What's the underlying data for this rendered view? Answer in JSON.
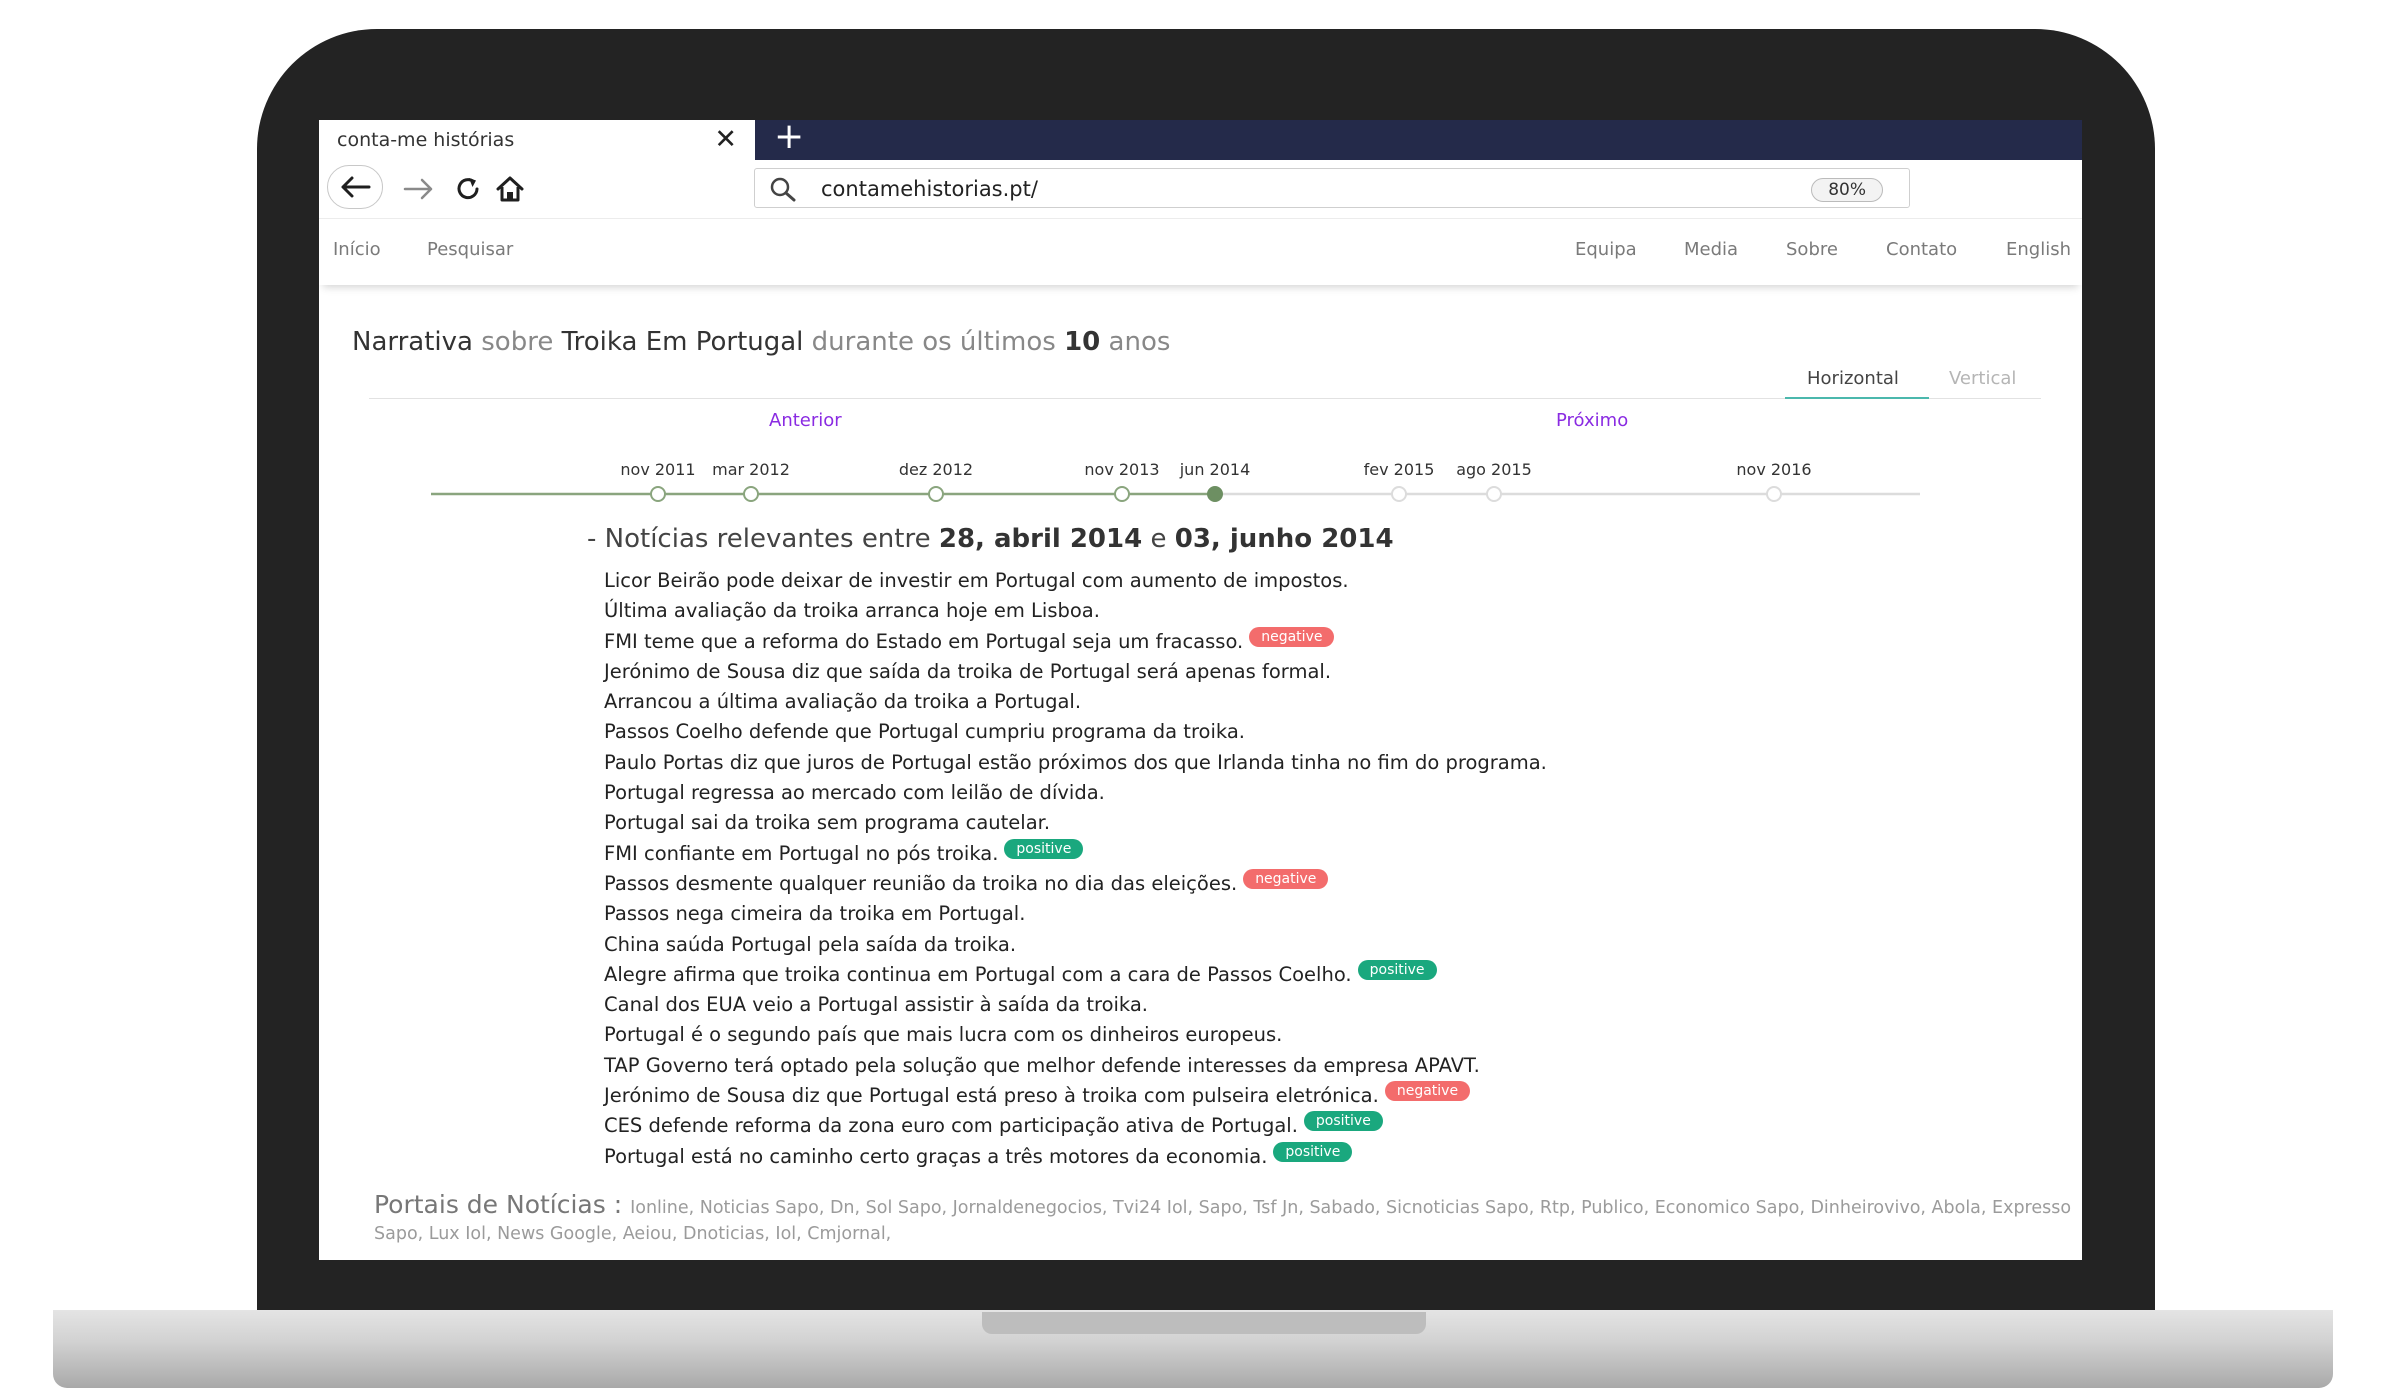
{
  "browser": {
    "tab_title": "conta-me histórias",
    "tab_close": "✕",
    "new_tab": "+",
    "url": "contamehistorias.pt/",
    "zoom": "80%"
  },
  "site_nav": {
    "left": [
      "Início",
      "Pesquisar"
    ],
    "right": [
      "Equipa",
      "Media",
      "Sobre",
      "Contato",
      "English"
    ]
  },
  "heading": {
    "part1": "Narrativa",
    "part2": " sobre ",
    "part3": "Troika Em Portugal",
    "part4": " durante os últimos ",
    "part5": "10",
    "part6": " anos"
  },
  "view_tabs": {
    "horizontal": "Horizontal",
    "vertical": "Vertical",
    "active": "horizontal"
  },
  "pager": {
    "previous": "Anterior",
    "next": "Próximo"
  },
  "timeline": {
    "dates": [
      "nov 2011",
      "mar 2012",
      "dez 2012",
      "nov 2013",
      "jun 2014",
      "fev 2015",
      "ago 2015",
      "nov 2016"
    ],
    "selected_index": 4,
    "colors": {
      "active_line": "#8aa57e",
      "inactive_line": "#dcdcdc",
      "selected_dot": "#6d8f62"
    }
  },
  "news_section": {
    "prefix": "- Notícias relevantes entre ",
    "start_date": "28, abril 2014",
    "connector": " e ",
    "end_date": "03, junho 2014"
  },
  "news": [
    {
      "text": "Licor Beirão pode deixar de investir em Portugal com aumento de impostos.",
      "badge": ""
    },
    {
      "text": "Última avaliação da troika arranca hoje em Lisboa.",
      "badge": ""
    },
    {
      "text": "FMI teme que a reforma do Estado em Portugal seja um fracasso.",
      "badge": "negative"
    },
    {
      "text": "Jerónimo de Sousa diz que saída da troika de Portugal será apenas formal.",
      "badge": ""
    },
    {
      "text": "Arrancou a última avaliação da troika a Portugal.",
      "badge": ""
    },
    {
      "text": "Passos Coelho defende que Portugal cumpriu programa da troika.",
      "badge": ""
    },
    {
      "text": "Paulo Portas diz que juros de Portugal estão próximos dos que Irlanda tinha no fim do programa.",
      "badge": ""
    },
    {
      "text": "Portugal regressa ao mercado com leilão de dívida.",
      "badge": ""
    },
    {
      "text": "Portugal sai da troika sem programa cautelar.",
      "badge": ""
    },
    {
      "text": "FMI confiante em Portugal no pós troika.",
      "badge": "positive"
    },
    {
      "text": "Passos desmente qualquer reunião da troika no dia das eleições.",
      "badge": "negative"
    },
    {
      "text": "Passos nega cimeira da troika em Portugal.",
      "badge": ""
    },
    {
      "text": "China saúda Portugal pela saída da troika.",
      "badge": ""
    },
    {
      "text": "Alegre afirma que troika continua em Portugal com a cara de Passos Coelho.",
      "badge": "positive"
    },
    {
      "text": "Canal dos EUA veio a Portugal assistir à saída da troika.",
      "badge": ""
    },
    {
      "text": "Portugal é o segundo país que mais lucra com os dinheiros europeus.",
      "badge": ""
    },
    {
      "text": "TAP Governo terá optado pela solução que melhor defende interesses da empresa APAVT.",
      "badge": ""
    },
    {
      "text": "Jerónimo de Sousa diz que Portugal está preso à troika com pulseira eletrónica.",
      "badge": "negative"
    },
    {
      "text": "CES defende reforma da zona euro com participação ativa de Portugal.",
      "badge": "positive"
    },
    {
      "text": "Portugal está no caminho certo graças a três motores da economia.",
      "badge": "positive"
    }
  ],
  "portals": {
    "label": "Portais de Notícias : ",
    "list": "Ionline, Noticias Sapo, Dn, Sol Sapo, Jornaldenegocios, Tvi24 Iol, Sapo, Tsf Jn, Sabado, Sicnoticias Sapo, Rtp, Publico, Economico Sapo, Dinheirovivo, Abola, Expresso Sapo, Lux Iol, News Google, Aeiou, Dnoticias, Iol, Cmjornal,"
  },
  "icons": {
    "back": "arrow-left-icon",
    "forward": "arrow-right-icon",
    "reload": "reload-icon",
    "home": "home-icon",
    "search": "search-icon"
  },
  "colors": {
    "tabbar": "#242a4a",
    "negative": "#f36c6c",
    "positive": "#1aa87e",
    "pager": "#8a2be2",
    "tab_underline": "#4bb8ad"
  }
}
